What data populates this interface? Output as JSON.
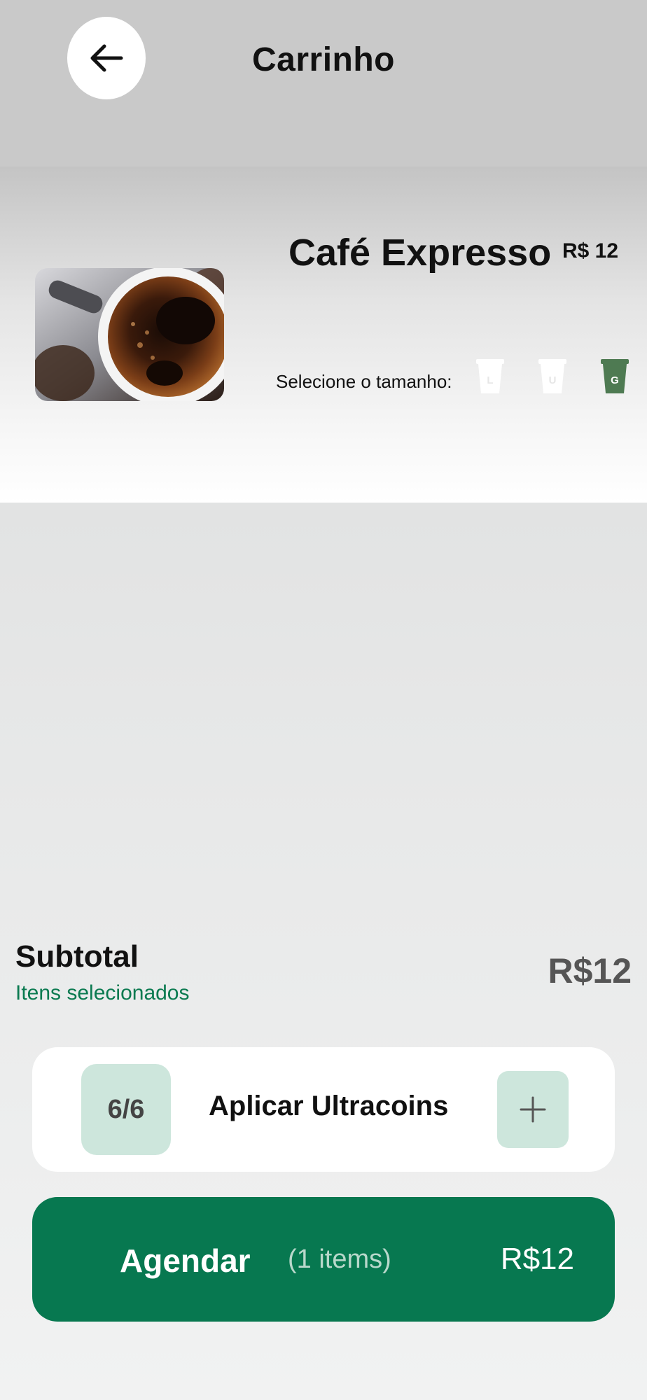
{
  "header": {
    "title": "Carrinho",
    "back_icon": "arrow-left-icon"
  },
  "product": {
    "name": "Café Expresso",
    "price": "R$ 12",
    "image": "espresso-cup-photo",
    "size_label": "Selecione o tamanho:",
    "sizes": [
      {
        "letter": "L",
        "selected": false
      },
      {
        "letter": "U",
        "selected": false
      },
      {
        "letter": "G",
        "selected": true
      }
    ]
  },
  "summary": {
    "title": "Subtotal",
    "subtitle": "Itens selecionados",
    "value": "R$12"
  },
  "coins": {
    "count": "6/6",
    "label": "Aplicar Ultracoins",
    "add_icon": "plus-icon"
  },
  "schedule": {
    "label": "Agendar",
    "count": "(1 items)",
    "total": "R$12"
  },
  "colors": {
    "accent": "#077850",
    "accent_light": "#cde6dc",
    "cup_unselected": "#ffffff",
    "cup_selected": "#4e7a52"
  }
}
